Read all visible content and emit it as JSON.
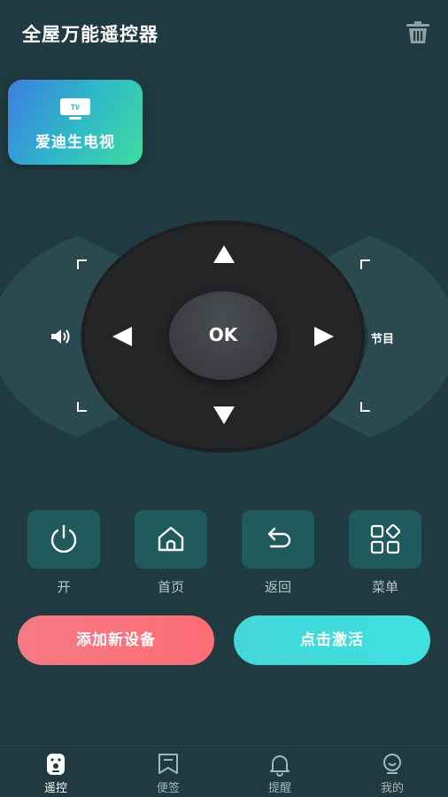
{
  "header": {
    "title": "全屋万能遥控器",
    "trash_icon": "trash-icon"
  },
  "device": {
    "name": "爱迪生电视",
    "icon_text": "TV",
    "icon": "tv-icon"
  },
  "remote": {
    "ok_label": "OK",
    "channel_label": "节目",
    "volume_icon": "volume-icon",
    "plus_glyph": "⌐",
    "minus_glyph": "⌙"
  },
  "actions": [
    {
      "label": "开",
      "icon": "power-icon"
    },
    {
      "label": "首页",
      "icon": "home-icon"
    },
    {
      "label": "返回",
      "icon": "back-icon"
    },
    {
      "label": "菜单",
      "icon": "menu-icon"
    }
  ],
  "buttons": {
    "add_device": "添加新设备",
    "activate": "点击激活"
  },
  "tabs": [
    {
      "label": "遥控",
      "icon": "remote-icon",
      "active": true
    },
    {
      "label": "便签",
      "icon": "note-icon",
      "active": false
    },
    {
      "label": "提醒",
      "icon": "bell-icon",
      "active": false
    },
    {
      "label": "我的",
      "icon": "profile-icon",
      "active": false
    }
  ],
  "colors": {
    "background": "#1f3a40",
    "tile": "#1f5a5d",
    "add_button": "#fe6d76",
    "activate_button": "#3fe0e0",
    "pad": "#222426"
  }
}
